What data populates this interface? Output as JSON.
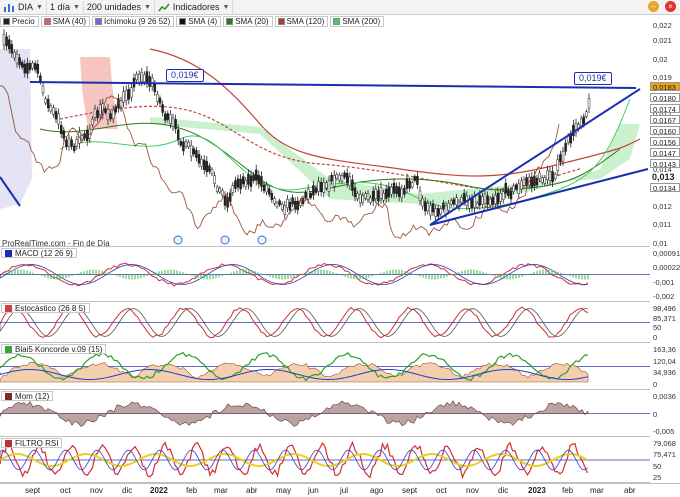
{
  "toolbar": {
    "symbol": "DIA",
    "timeframe": "1 día",
    "units": "200 unidades",
    "indicators_label": "Indicadores"
  },
  "legend": [
    {
      "name": "Precio",
      "color": "#222222"
    },
    {
      "name": "SMA (40)",
      "color": "#e06060"
    },
    {
      "name": "Ichimoku (9 26 52)",
      "color": "#6a6ad8"
    },
    {
      "name": "SMA (4)",
      "color": "#111111"
    },
    {
      "name": "SMA (20)",
      "color": "#2d7a1e"
    },
    {
      "name": "SMA (120)",
      "color": "#b0392c"
    },
    {
      "name": "SMA (200)",
      "color": "#3fcf5f"
    }
  ],
  "price_panel": {
    "source": "ProRealTime.com - Fin de Día",
    "callouts": [
      "0,019€",
      "0,019€"
    ],
    "axis_ticks": [
      "0,022",
      "0,021",
      "0,02",
      "0,019",
      "0,018",
      "0,017",
      "0,016",
      "0,015",
      "0,014",
      "0,013",
      "0,012",
      "0,011",
      "0,01"
    ],
    "tags": [
      {
        "text": "0,0183",
        "color": "#e8a21c"
      },
      {
        "text": "0,0180",
        "color": "#ffffff"
      },
      {
        "text": "0,0174",
        "color": "#ffffff"
      },
      {
        "text": "0,0167",
        "color": "#ffffff"
      },
      {
        "text": "0,0160",
        "color": "#ffffff"
      },
      {
        "text": "0,0156",
        "color": "#ffffff"
      },
      {
        "text": "0,0147",
        "color": "#ffffff"
      },
      {
        "text": "0,0143",
        "color": "#ffffff"
      },
      {
        "text": "0,013",
        "color": "#ffffff"
      },
      {
        "text": "0,0134",
        "color": "#ffffff"
      }
    ]
  },
  "panels": [
    {
      "title": "MACD (12 26 9)",
      "color": "#2525b5",
      "ticks": [
        "0,00091",
        "0,00022",
        "-0,001",
        "-0,002"
      ]
    },
    {
      "title": "Estocástico (26 8 5)",
      "color": "#d04040",
      "ticks": [
        "98,496",
        "85,371",
        "50",
        "0"
      ]
    },
    {
      "title": "Blai5 Koncorde v.09 (15)",
      "color": "#3aa03a",
      "ticks": [
        "163,36",
        "120,04",
        "34,936",
        "0"
      ]
    },
    {
      "title": "Mom (12)",
      "color": "#7a2a2a",
      "ticks": [
        "0,0036",
        "0",
        "-0,005"
      ]
    },
    {
      "title": "FILTRO RSI",
      "color": "#c03030",
      "ticks": [
        "79,068",
        "75,471",
        "50",
        "25"
      ]
    }
  ],
  "x_axis": [
    "sept",
    "oct",
    "nov",
    "dic",
    "2022",
    "feb",
    "mar",
    "abr",
    "may",
    "jun",
    "jul",
    "ago",
    "sept",
    "oct",
    "nov",
    "dic",
    "2023",
    "feb",
    "mar",
    "abr"
  ],
  "colors": {
    "trendline": "#1a2fb0",
    "price": "#222222",
    "highlight_tag": "#e8a21c"
  }
}
